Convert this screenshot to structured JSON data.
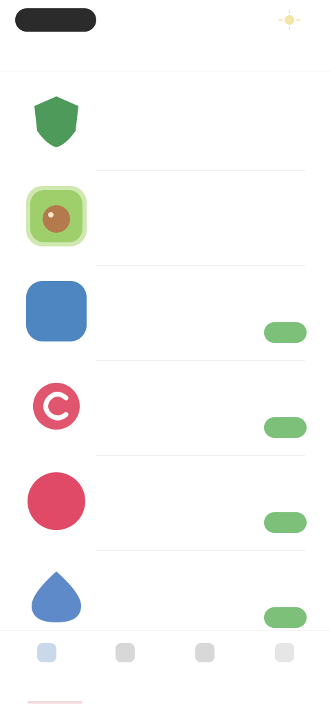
{
  "header": {
    "back_label": "",
    "title": "",
    "sun_icon": "sun-icon"
  },
  "apps": [
    {
      "name": "",
      "subtitle": "",
      "icon_color": "#4d9a5b",
      "button": ""
    },
    {
      "name": "",
      "subtitle": "",
      "icon_color": "#9fcf6a",
      "button": ""
    },
    {
      "name": "",
      "subtitle": "",
      "icon_color": "#4d86c0",
      "button": ""
    },
    {
      "name": "",
      "subtitle": "",
      "icon_color": "#e0566f",
      "button": ""
    },
    {
      "name": "",
      "subtitle": "",
      "icon_color": "#e04a66",
      "button": ""
    },
    {
      "name": "",
      "subtitle": "",
      "icon_color": "#5f8ac9",
      "button": ""
    }
  ],
  "nav": {
    "items": [
      {
        "label": "",
        "icon": "home-icon"
      },
      {
        "label": "",
        "icon": "apps-icon"
      },
      {
        "label": "",
        "icon": "games-icon"
      },
      {
        "label": "",
        "icon": "profile-icon"
      }
    ]
  },
  "colors": {
    "accent_green": "#7cc07a",
    "active_tab": "#d55a6a"
  }
}
